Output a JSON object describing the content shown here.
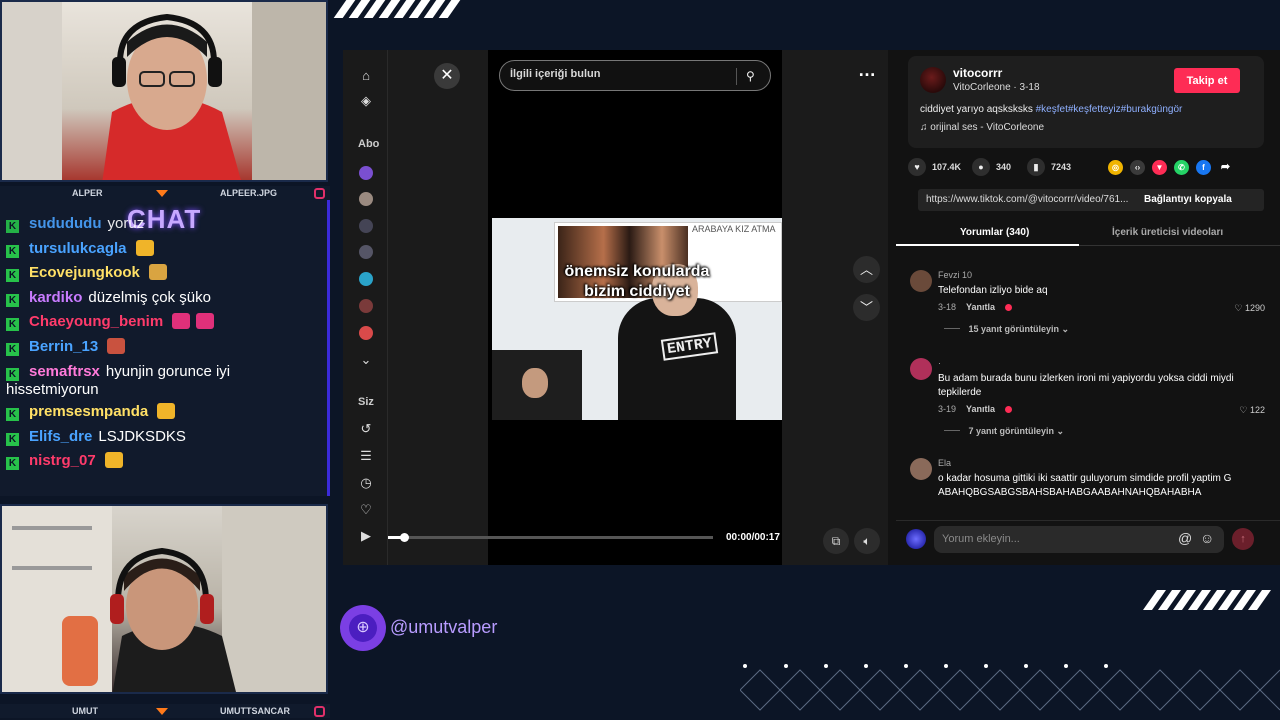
{
  "overlay": {
    "cam_top": {
      "left_name": "ALPER",
      "right_name": "ALPEER.JPG"
    },
    "cam_bottom": {
      "left_name": "UMUT",
      "right_name": "UMUTTSANCAR"
    },
    "social_handle": "@umutvalper",
    "accent_colors": {
      "purple": "#7b3fe4",
      "orange": "#ff7a1a",
      "tiktok_red": "#fe2c55"
    }
  },
  "chat": {
    "title": "CHAT",
    "messages": [
      {
        "user": "sudududu",
        "text": "yoruz",
        "color": "#4aa3ff",
        "partial": true
      },
      {
        "user": "tursulukcagla",
        "text": "",
        "color": "#4aa3ff",
        "emote": "#f0b429"
      },
      {
        "user": "Ecovejungkook",
        "text": "",
        "color": "#ffe066",
        "emote": "#d9a441"
      },
      {
        "user": "kardiko",
        "text": "düzelmiş çok şüko",
        "color": "#c87bff"
      },
      {
        "user": "Chaeyoung_benim",
        "text": "",
        "color": "#ff3b6b",
        "emote": "#e0307a"
      },
      {
        "user": "Berrin_13",
        "text": "",
        "color": "#4aa3ff",
        "emote": "#c9523f"
      },
      {
        "user": "semaftrsx",
        "text": "hyunjin gorunce iyi hissetmiyorun",
        "color": "#ff7ad9"
      },
      {
        "user": "premsesmpanda",
        "text": "",
        "color": "#ffe066",
        "emote": "#f0b429"
      },
      {
        "user": "Elifs_dre",
        "text": "LSJDKSDKS",
        "color": "#4aa3ff"
      },
      {
        "user": "nistrg_07",
        "text": "",
        "color": "#ff3b6b",
        "emote": "#f0b429"
      }
    ]
  },
  "tiktok": {
    "search_placeholder": "İlgili içeriği bulun",
    "nav": {
      "following_label": "Abo",
      "you_label": "Siz"
    },
    "video": {
      "caption_line1": "önemsiz konularda",
      "caption_line2": "bizim ciddiyet",
      "slide_title": "ARABAYA KIZ ATMA",
      "shirt_text": "ENTRY",
      "time": "00:00/00:17",
      "progress": 0.05
    },
    "author": {
      "username": "vitocorrr",
      "display_name": "VitoCorleone",
      "date": "3-18",
      "follow_label": "Takip et"
    },
    "description": {
      "text": "ciddiyet yarıyo aqsksksks ",
      "hashtags": "#keşfet#keşfetteyiz#burakgüngör"
    },
    "music": "orijinal ses - VitoCorleone",
    "stats": {
      "likes": "107.4K",
      "comments": "340",
      "saves": "7243"
    },
    "share_link": "https://www.tiktok.com/@vitocorrr/video/761...",
    "copy_link_label": "Bağlantıyı kopyala",
    "tabs": {
      "comments": "Yorumlar (340)",
      "creator_videos": "İçerik üreticisi videoları"
    },
    "comments": [
      {
        "user": "Fevzi 10",
        "text": "Telefondan izliyo bide aq",
        "date": "3-18",
        "reply": "Yanıtla",
        "likes": "1290",
        "replies": "15 yanıt görüntüleyin",
        "avatar": "#6a4a3a"
      },
      {
        "user": "·",
        "text": "Bu adam burada bunu izlerken ironi mi yapiyordu yoksa ciddi miydi tepkilerde",
        "date": "3-19",
        "reply": "Yanıtla",
        "likes": "122",
        "replies": "7 yanıt görüntüleyin",
        "avatar": "#b0305a"
      },
      {
        "user": "Ela",
        "text": "o kadar hosuma gittiki iki saattir guluyorum simdide profil yaptim GABAHQBGSABGSBAHSBAHABGAABAHNAHQBAHABHA",
        "avatar": "#8a6a5a"
      }
    ],
    "composer_placeholder": "Yorum ekleyin..."
  }
}
